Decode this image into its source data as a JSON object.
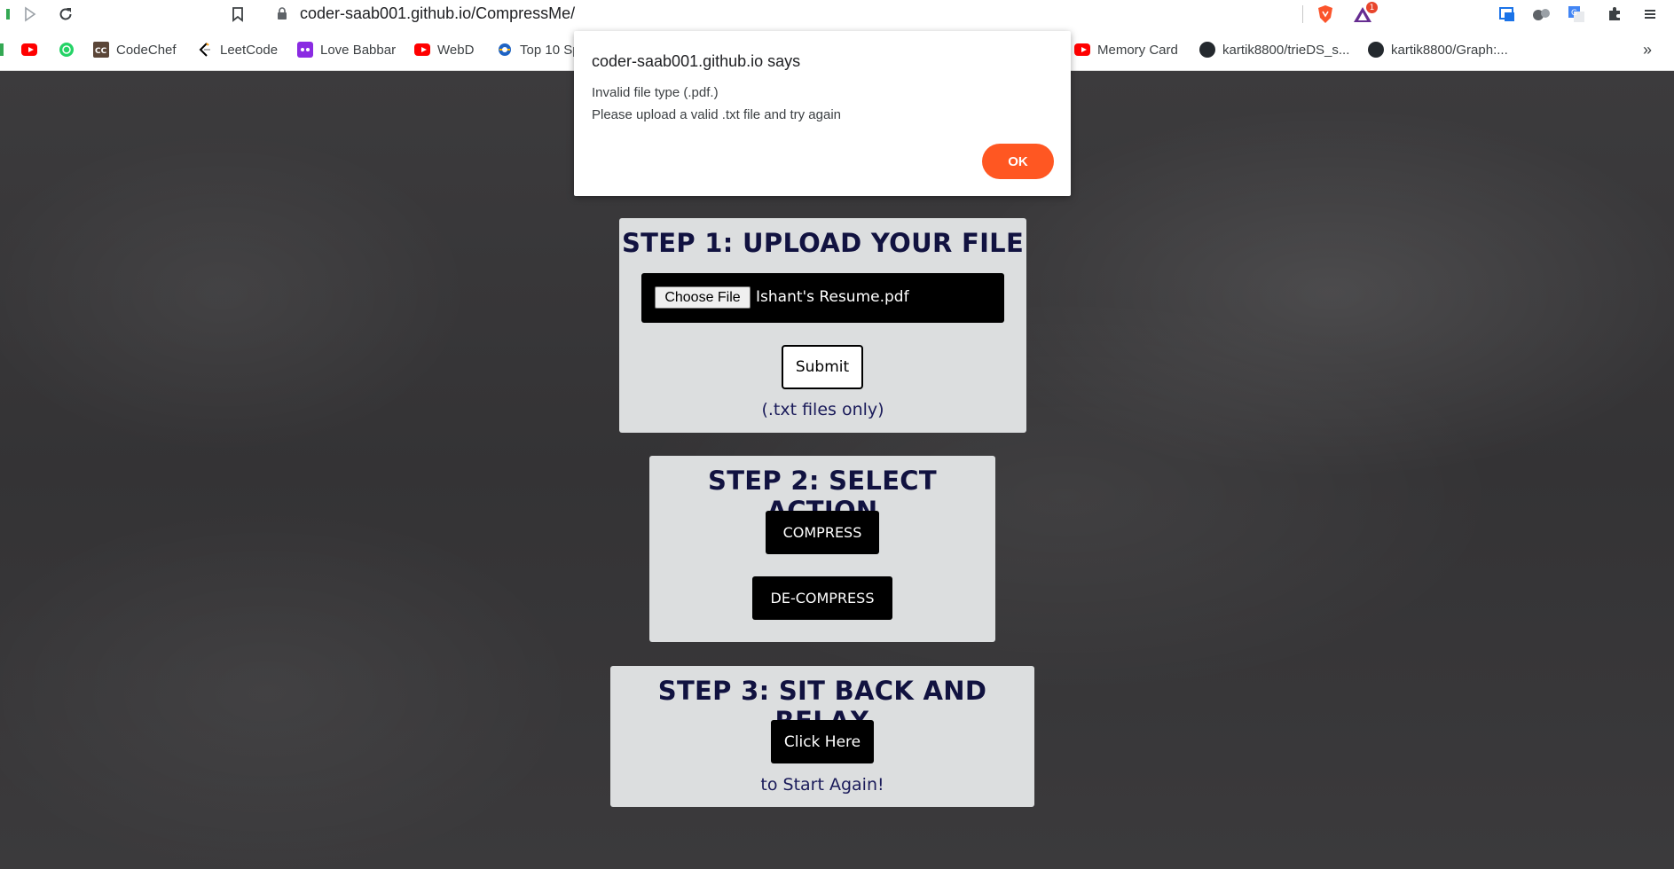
{
  "browser": {
    "url": "coder-saab001.github.io/CompressMe/",
    "bookmarks": [
      {
        "label": "CodeChef",
        "icon": "codechef-icon"
      },
      {
        "label": "LeetCode",
        "icon": "leetcode-icon"
      },
      {
        "label": "Love Babbar",
        "icon": "lovebabbar-icon"
      },
      {
        "label": "WebD",
        "icon": "youtube-icon"
      },
      {
        "label": "Top 10 Sp",
        "icon": "globe-icon"
      },
      {
        "label": "Memory Card",
        "icon": "youtube-icon"
      },
      {
        "label": "kartik8800/trieDS_s...",
        "icon": "github-icon"
      },
      {
        "label": "kartik8800/Graph:...",
        "icon": "github-icon"
      }
    ],
    "more_bookmarks": "»",
    "extension_badge": "1"
  },
  "dialog": {
    "title": "coder-saab001.github.io says",
    "line1": "Invalid file type (.pdf.)",
    "line2": "Please upload a valid .txt file and try again",
    "ok_label": "OK"
  },
  "step1": {
    "heading": "STEP 1: UPLOAD YOUR FILE",
    "choose_file_label": "Choose File",
    "file_name": "Ishant's Resume.pdf",
    "submit_label": "Submit",
    "note": "(.txt files only)"
  },
  "step2": {
    "heading": "STEP 2: SELECT ACTION",
    "compress_label": "COMPRESS",
    "decompress_label": "DE-COMPRESS"
  },
  "step3": {
    "heading": "STEP 3: SIT BACK AND RELAX",
    "click_label": "Click Here",
    "note": "to Start Again!"
  },
  "colors": {
    "heading": "#111240",
    "card": "#dcdedf",
    "ok_button": "#ff5722",
    "page_background": "#3a393b"
  }
}
